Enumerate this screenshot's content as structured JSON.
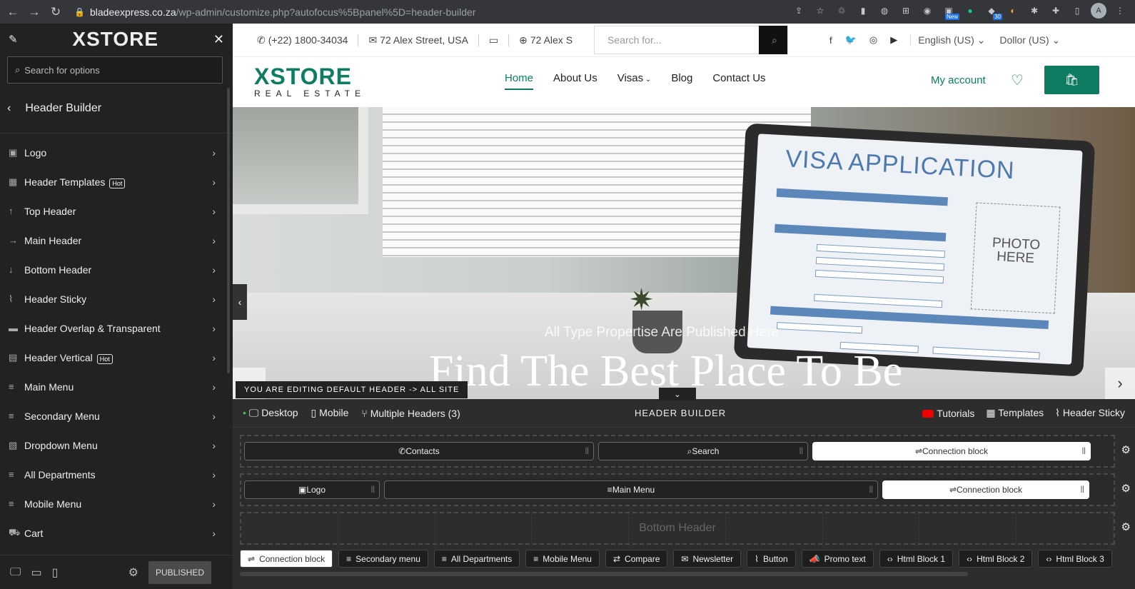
{
  "browser": {
    "url_host": "bladeexpress.co.za",
    "url_path": "/wp-admin/customize.php?autofocus%5Bpanel%5D=header-builder",
    "profile_initial": "A",
    "ext_badge_new": "New",
    "ext_badge_30": "30"
  },
  "sidebar": {
    "logo": "XSTORE",
    "search_placeholder": "Search for options",
    "section_title": "Header Builder",
    "hot_label": "Hot",
    "items": [
      {
        "label": "Logo",
        "icon": "image-icon"
      },
      {
        "label": "Header Templates",
        "icon": "grid-icon",
        "hot": true
      },
      {
        "label": "Top Header",
        "icon": "arrow-up-icon"
      },
      {
        "label": "Main Header",
        "icon": "arrow-right-icon"
      },
      {
        "label": "Bottom Header",
        "icon": "arrow-down-icon"
      },
      {
        "label": "Header Sticky",
        "icon": "paperclip-icon"
      },
      {
        "label": "Header Overlap & Transparent",
        "icon": "layers-icon"
      },
      {
        "label": "Header Vertical",
        "icon": "sidebar-icon",
        "hot": true
      },
      {
        "label": "Main Menu",
        "icon": "menu-icon"
      },
      {
        "label": "Secondary Menu",
        "icon": "menu-icon"
      },
      {
        "label": "Dropdown Menu",
        "icon": "dropdown-icon"
      },
      {
        "label": "All Departments",
        "icon": "menu-icon"
      },
      {
        "label": "Mobile Menu",
        "icon": "menu-icon"
      },
      {
        "label": "Cart",
        "icon": "cart-icon"
      }
    ],
    "publish_label": "PUBLISHED"
  },
  "site": {
    "phone": "(+22) 1800-34034",
    "address": "72 Alex Street, USA",
    "address_short": "72 Alex S",
    "search_placeholder": "Search for...",
    "language": "English (US)",
    "currency": "Dollor (US)",
    "brand_main": "XSTORE",
    "brand_sub": "REAL ESTATE",
    "menu": [
      {
        "label": "Home",
        "active": true
      },
      {
        "label": "About Us"
      },
      {
        "label": "Visas"
      },
      {
        "label": "Blog"
      },
      {
        "label": "Contact Us"
      }
    ],
    "account": "My account",
    "brand_color": "#0e7c62"
  },
  "hero": {
    "laptop_title": "VISA APPLICATION",
    "photo_text": "PHOTO HERE",
    "subtitle": "All Type Propertise Are Published Here",
    "title": "Find The Best Place To Be"
  },
  "builder": {
    "editing_notice": "YOU ARE EDITING DEFAULT HEADER -> ALL SITE",
    "devices": [
      "Desktop",
      "Mobile"
    ],
    "multiple_headers": "Multiple Headers (3)",
    "title": "HEADER BUILDER",
    "tutorials": "Tutorials",
    "templates": "Templates",
    "header_sticky": "Header Sticky",
    "top_row": [
      "Contacts",
      "Search",
      "Connection block"
    ],
    "main_row": [
      "Logo",
      "Main Menu",
      "Connection block"
    ],
    "bottom_label": "Bottom Header",
    "chips": [
      "Connection block",
      "Secondary menu",
      "All Departments",
      "Mobile Menu",
      "Compare",
      "Newsletter",
      "Button",
      "Promo text",
      "Html Block 1",
      "Html Block 2",
      "Html Block 3"
    ]
  }
}
